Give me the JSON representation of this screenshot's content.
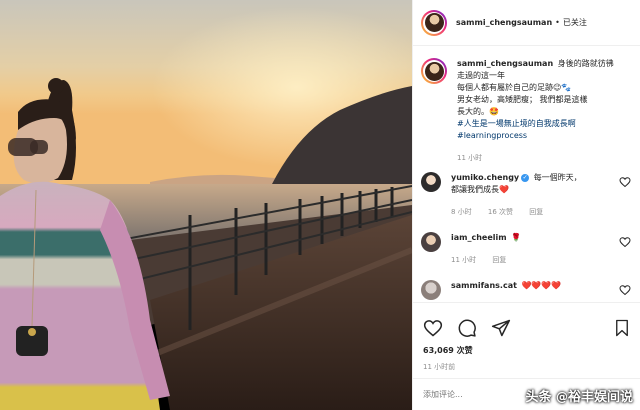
{
  "header": {
    "username": "sammi_chengsauman",
    "separator": "•",
    "follow_status": "已关注"
  },
  "caption": {
    "username": "sammi_chengsauman",
    "text_lines": [
      "身後的路就彷彿",
      "走過的這一年",
      "每個人都有屬於自己的足跡😉🐾",
      "男女老幼，高矮肥瘦；  我們都是這樣",
      "長大的。🤩"
    ],
    "hashtags": [
      "#人生是一場無止境的自我成長啊",
      "#learningprocess"
    ],
    "time": "11 小时"
  },
  "comments": [
    {
      "username": "yumiko.chengy",
      "verified": true,
      "text_lines": [
        "每一個昨天，",
        "都讓我們成長❤️"
      ],
      "time": "8 小时",
      "likes": "16 次赞",
      "reply": "回复"
    },
    {
      "username": "iam_cheelim",
      "verified": false,
      "text_lines": [
        "🌹"
      ],
      "time": "11 小时",
      "reply": "回复"
    },
    {
      "username": "sammifans.cat",
      "verified": false,
      "text_lines": [
        "❤️❤️❤️❤️"
      ]
    }
  ],
  "actions": {
    "likes": "63,069 次赞",
    "time_ago": "11 小时前"
  },
  "add_comment": {
    "placeholder": "添加评论..."
  },
  "watermark": {
    "brand": "头条",
    "at": "@",
    "author": "裕丰娱间说"
  },
  "icons": [
    "heart-icon",
    "comment-icon",
    "share-icon",
    "bookmark-icon"
  ],
  "colors": {
    "hashtag": "#00376b",
    "meta_gray": "#8e8e8e",
    "verified_blue": "#3897f0",
    "heart_red": "#ed4956"
  }
}
